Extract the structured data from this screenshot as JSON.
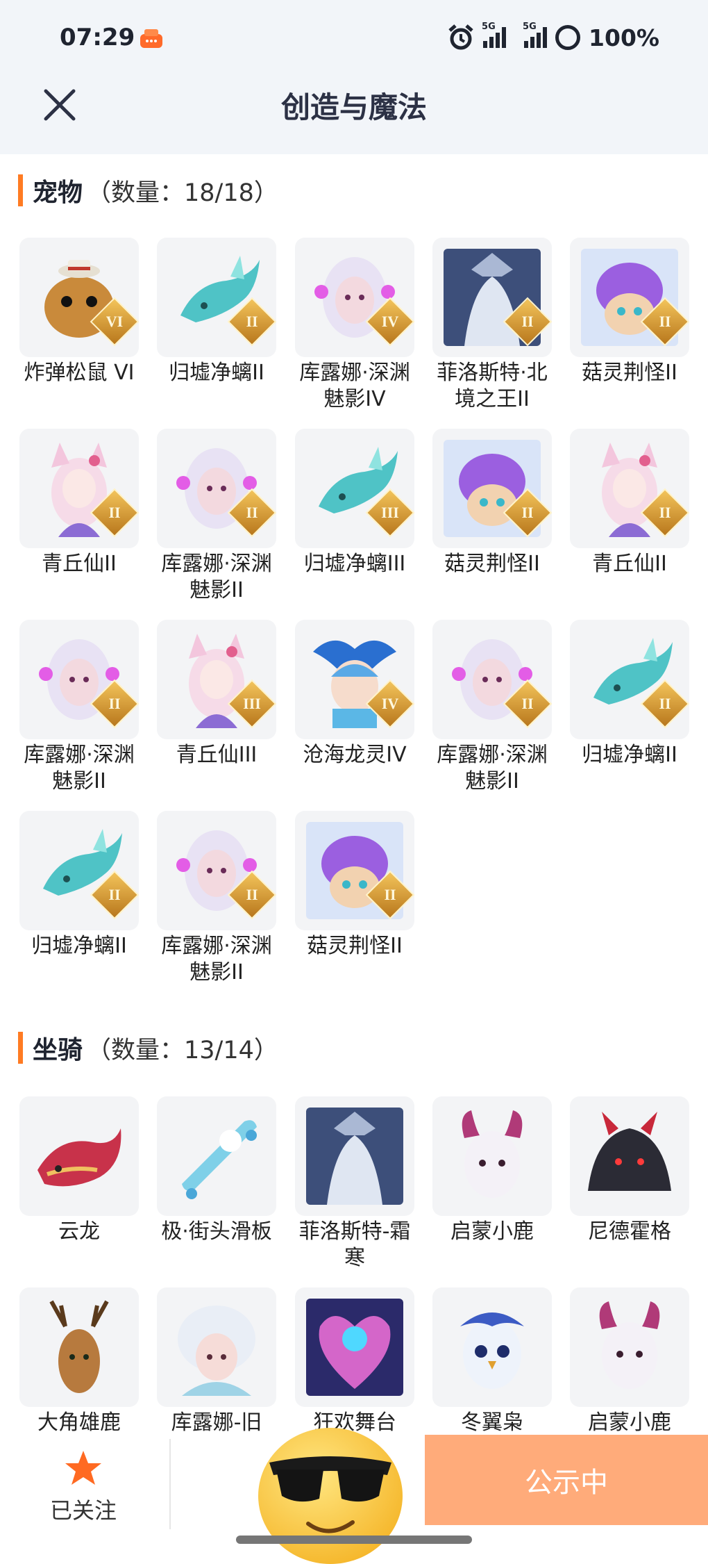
{
  "status_bar": {
    "time": "07:29",
    "signal_1_label": "5G",
    "signal_2_label": "5G",
    "battery": "100%"
  },
  "header": {
    "title": "创造与魔法"
  },
  "sections": {
    "pets": {
      "title": "宠物",
      "count": "（数量：18/18）",
      "items": [
        {
          "name": "炸弹松鼠 VI",
          "badge": "VI",
          "art": "squirrel",
          "color": "#c98a3b"
        },
        {
          "name": "归墟净螭II",
          "badge": "II",
          "art": "dragon",
          "color": "#4fc3c6"
        },
        {
          "name": "库露娜·深渊魅影IV",
          "badge": "IV",
          "art": "kuluna",
          "color": "#e8e2f4"
        },
        {
          "name": "菲洛斯特·北境之王II",
          "badge": "II",
          "art": "philost",
          "color": "#3d4f7a"
        },
        {
          "name": "菇灵荆怪II",
          "badge": "II",
          "art": "mushroom",
          "color": "#9b5fe0"
        },
        {
          "name": "青丘仙II",
          "badge": "II",
          "art": "fox",
          "color": "#f3c6dd"
        },
        {
          "name": "库露娜·深渊魅影II",
          "badge": "II",
          "art": "kuluna",
          "color": "#e8e2f4"
        },
        {
          "name": "归墟净螭III",
          "badge": "III",
          "art": "dragon",
          "color": "#4fc3c6"
        },
        {
          "name": "菇灵荆怪II",
          "badge": "II",
          "art": "mushroom",
          "color": "#9b5fe0"
        },
        {
          "name": "青丘仙II",
          "badge": "II",
          "art": "fox",
          "color": "#f3c6dd"
        },
        {
          "name": "库露娜·深渊魅影II",
          "badge": "II",
          "art": "kuluna",
          "color": "#e8e2f4"
        },
        {
          "name": "青丘仙III",
          "badge": "III",
          "art": "fox",
          "color": "#f3c6dd"
        },
        {
          "name": "沧海龙灵IV",
          "badge": "IV",
          "art": "seadragon",
          "color": "#5aa9e6"
        },
        {
          "name": "库露娜·深渊魅影II",
          "badge": "II",
          "art": "kuluna",
          "color": "#e8e2f4"
        },
        {
          "name": "归墟净螭II",
          "badge": "II",
          "art": "dragon",
          "color": "#4fc3c6"
        },
        {
          "name": "归墟净螭II",
          "badge": "II",
          "art": "dragon",
          "color": "#4fc3c6"
        },
        {
          "name": "库露娜·深渊魅影II",
          "badge": "II",
          "art": "kuluna",
          "color": "#e8e2f4"
        },
        {
          "name": "菇灵荆怪II",
          "badge": "II",
          "art": "mushroom",
          "color": "#9b5fe0"
        }
      ]
    },
    "mounts": {
      "title": "坐骑",
      "count": "（数量：13/14）",
      "items": [
        {
          "name": "云龙",
          "art": "cloud-dragon",
          "color": "#c8324a"
        },
        {
          "name": "极·街头滑板",
          "art": "skateboard",
          "color": "#7fd0e8"
        },
        {
          "name": "菲洛斯特-霜寒",
          "art": "philost",
          "color": "#3d4f7a"
        },
        {
          "name": "启蒙小鹿",
          "art": "deer-white",
          "color": "#b03a78"
        },
        {
          "name": "尼德霍格",
          "art": "nidhogg",
          "color": "#2b2b35"
        },
        {
          "name": "大角雄鹿",
          "art": "stag",
          "color": "#b77a3e"
        },
        {
          "name": "库露娜-旧",
          "art": "kuluna-old",
          "color": "#9fd3e6"
        },
        {
          "name": "狂欢舞台",
          "art": "stage",
          "color": "#d466c9"
        },
        {
          "name": "冬翼枭",
          "art": "owl",
          "color": "#3c5bc4"
        },
        {
          "name": "启蒙小鹿",
          "art": "deer-white",
          "color": "#b03a78"
        }
      ]
    }
  },
  "bottom_bar": {
    "follow_label": "已关注",
    "publish_label": "公示中"
  },
  "colors": {
    "accent": "#ff7b23",
    "publish": "#ffab7a",
    "header_bg": "#f2f5f9"
  }
}
